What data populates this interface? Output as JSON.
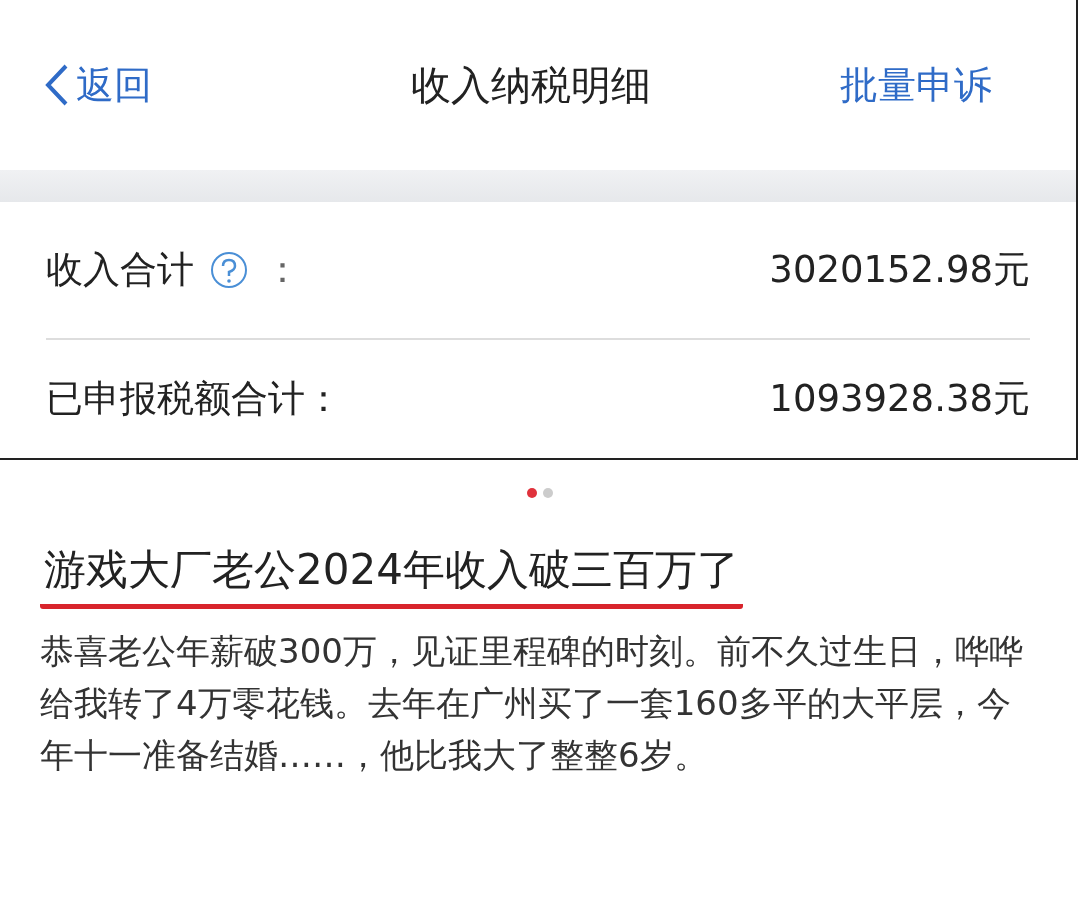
{
  "header": {
    "back": "返回",
    "title": "收入纳税明细",
    "action": "批量申诉"
  },
  "rows": [
    {
      "kind": "help",
      "label": "收入合计",
      "colon": "：",
      "value": "3020152.98元"
    },
    {
      "kind": "plain",
      "label": "已申报税额合计：",
      "value": "1093928.38元"
    }
  ],
  "pager": [
    {
      "selected": true
    },
    {
      "selected": false
    }
  ],
  "post": {
    "title": "游戏大厂老公2024年收入破三百万了",
    "body": "恭喜老公年薪破300万，见证里程碑的时刻。前不久过生日，哗哗给我转了4万零花钱。去年在广州买了一套160多平的大平层，今年十一准备结婚……，他比我大了整整6岁。"
  }
}
